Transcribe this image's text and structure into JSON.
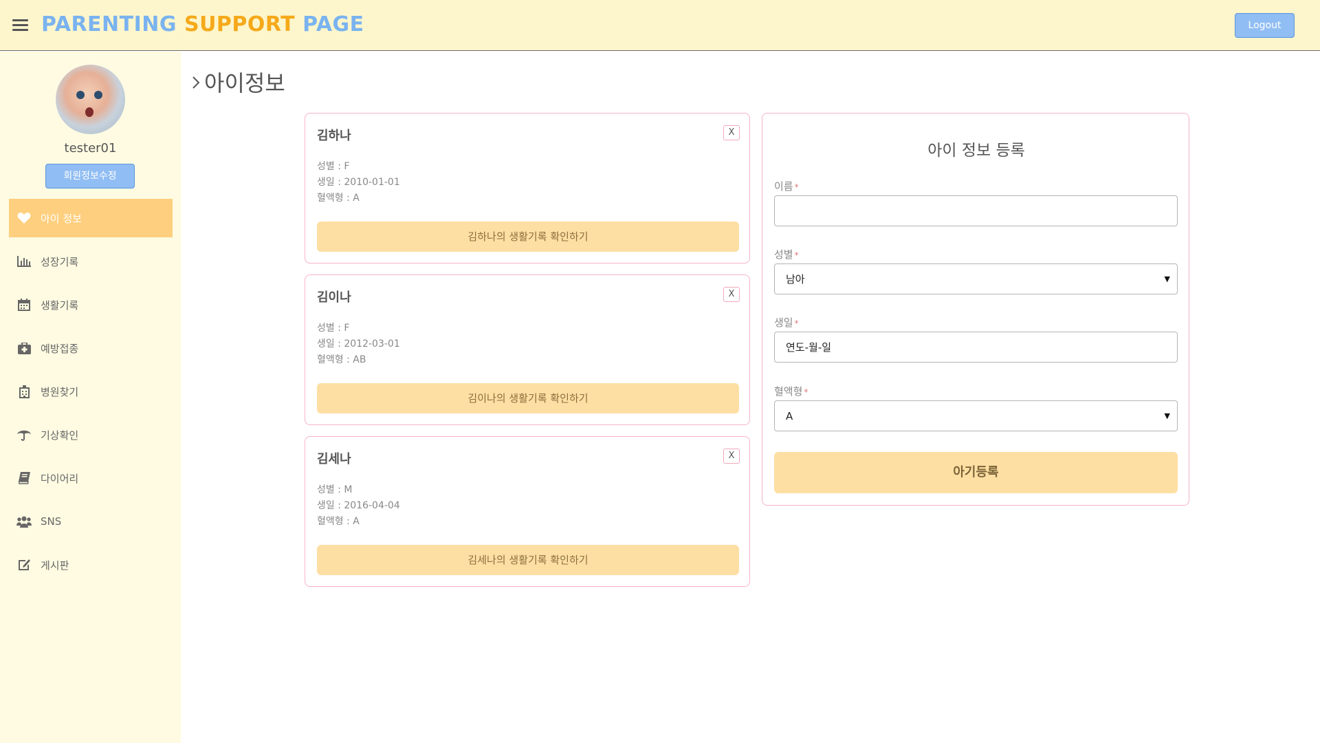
{
  "header": {
    "brand_part1": "PARENTING",
    "brand_part2": "SUPPORT",
    "brand_part3": "PAGE",
    "logout_label": "Logout"
  },
  "sidebar": {
    "username": "tester01",
    "edit_profile_label": "회원정보수정",
    "items": [
      {
        "label": "아이 정보",
        "icon": "heart-icon"
      },
      {
        "label": "성장기록",
        "icon": "bar-chart-icon"
      },
      {
        "label": "생활기록",
        "icon": "calendar-icon"
      },
      {
        "label": "예방접종",
        "icon": "medkit-icon"
      },
      {
        "label": "병원찾기",
        "icon": "hospital-icon"
      },
      {
        "label": "기상확인",
        "icon": "umbrella-icon"
      },
      {
        "label": "다이어리",
        "icon": "book-icon"
      },
      {
        "label": "SNS",
        "icon": "users-icon"
      },
      {
        "label": "게시판",
        "icon": "edit-icon"
      }
    ]
  },
  "main": {
    "page_title": "아이정보",
    "children": [
      {
        "name": "김하나",
        "close_label": "X",
        "gender": "성별 : F",
        "birth": "생일 : 2010-01-01",
        "blood": "혈액형 : A",
        "record_button": "김하나의 생활기록 확인하기"
      },
      {
        "name": "김이나",
        "close_label": "X",
        "gender": "성별 : F",
        "birth": "생일 : 2012-03-01",
        "blood": "혈액형 : AB",
        "record_button": "김이나의 생활기록 확인하기"
      },
      {
        "name": "김세나",
        "close_label": "X",
        "gender": "성별 : M",
        "birth": "생일 : 2016-04-04",
        "blood": "혈액형 : A",
        "record_button": "김세나의 생활기록 확인하기"
      }
    ]
  },
  "register": {
    "title": "아이 정보 등록",
    "name_label": "이름",
    "name_value": "",
    "gender_label": "성별",
    "gender_value": "남아",
    "birth_label": "생일",
    "birth_value": "연도-월-일",
    "blood_label": "혈액형",
    "blood_value": "A",
    "required_mark": "*",
    "submit_label": "아기등록"
  },
  "colors": {
    "header_bg": "#fdf6cc",
    "sidebar_bg": "#fefbe2",
    "active_item": "#fecf7e",
    "accent_blue": "#90bdf3",
    "brand_blue": "#7ab3ef",
    "brand_orange": "#f5a91a",
    "card_border": "#f6b3c6",
    "button_yellow": "#fedfa3"
  }
}
